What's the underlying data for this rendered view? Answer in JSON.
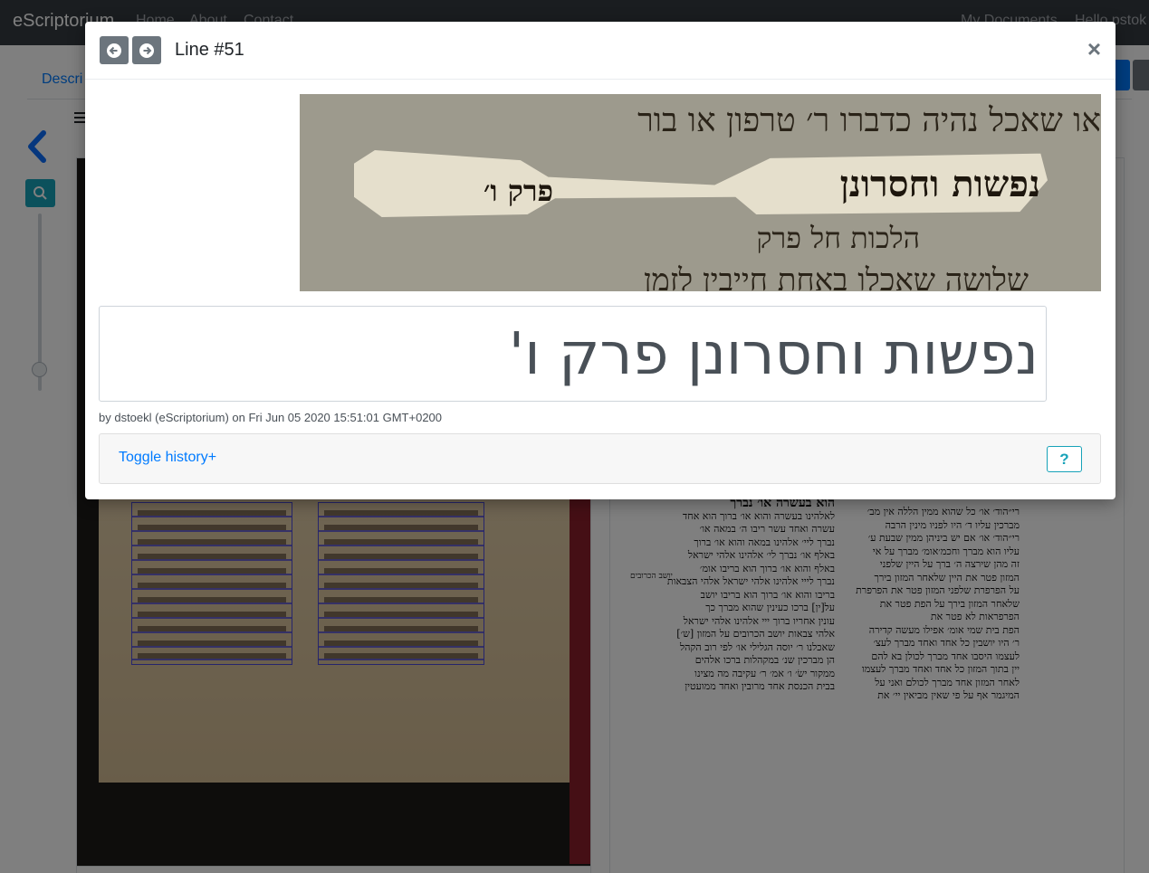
{
  "navbar": {
    "brand": "eScriptorium",
    "links": [
      "Home",
      "About",
      "Contact"
    ],
    "my_documents": "My Documents",
    "user": "Hello pstok"
  },
  "page": {
    "tab_label": "Descri"
  },
  "modal": {
    "title": "Line #51",
    "prev_icon": "arrow-circle-left-icon",
    "next_icon": "arrow-circle-right-icon",
    "close_label": "×",
    "image_lines": [
      "או שאכל נהיה כדברו ר׳ טרפון או בור",
      "הלכות חל פרק",
      "שלושה שאכלו באחת חייבין לזמן"
    ],
    "image_highlight_main": "נפשות וחסרונן",
    "image_highlight_sub": "פרק ו׳",
    "transcription": "נפשות וחסרונן פרק ו'",
    "author_line": "by dstoekl (eScriptorium) on Fri Jun 05 2020 15:51:01 GMT+0200",
    "toggle_history": "Toggle history+",
    "help_label": "?"
  },
  "transcription_panel": {
    "left_column_header": "הוא בעשרה או׳ נברך",
    "left_column": [
      "לאלהינו בעשרה והוא או׳ ברוך הוא אחד",
      "עשרה ואחד עשר ריבו ה׳ במאה או׳",
      "נברך ליי׳ אלהינו במאה והוא או׳ ברוך",
      "באלף או׳ נברך לי׳ אלהינו אלהי ישראל",
      "באלף והוא או׳ ברוך הוא בריבו אומ׳",
      "נברך לייי אלהינו אלהי ישראל אלהי הצבאות",
      "בריבו והוא או׳ ברוך הוא בריבו יושב",
      "על[ין] ברכו כעינין שהוא מברך כך",
      "עונין אחריו ברוך ייי אלהינו אלהי ישראל",
      "אלהי צבאות יושב הכרובים על המזון [ש׳]",
      "שאכלנו ר׳ יוסה הגלילי או׳ לפי רוב הקהל",
      "הן מברכין שנ׳ במקהלות ברכו אלהים",
      "ממקור ישׂ׳ ו׳ אמ׳ ר׳ עקיבה מה מצינו",
      "בבית הכנסת אחד מרובין ואחד ממועטין"
    ],
    "right_column": [
      "רי״הוד׳ או׳ כל שהוא ממין הללה אין מב׳",
      "מברכין עליו ד׳ היו לפניו מינין הרבה",
      "רי״הוד׳ או׳ אם יש ביניהן ממין שבעת ע׳",
      "עליו הוא מברך וחכמ׳אומ׳ מברך על אי",
      "זה מהן שירצה ה׳ ברך על היין שלפני",
      "המזון פטר את היין שלאחר המזון בירך",
      "על הפרפרת שלפני המזון פטר את הפרפרת",
      "שלאחר המזון בירך על הפת פטר את",
      "הפרפראות לא פטר את",
      "הפת בית שמי אומ׳ אפילו מעשה קדירה",
      "ר׳ היו יושבין כל אחד ואחד מברך לעצ׳",
      "לעצמו היסבו אחד מברך לכולן בא להם",
      "יין בתוך המזון כל אחד ואחד מברך לעצמו",
      "לאחר המזון אחד מברך לכולם ואני על",
      "המיגמר אף על פי שאין מביאין יי׳ את"
    ],
    "margin_note": "יושב הכרובים"
  },
  "colors": {
    "primary": "#007bff",
    "info": "#17a2b8",
    "secondary": "#6c757d",
    "navbar": "#343a40",
    "segmentation": "#4d4ad8"
  }
}
